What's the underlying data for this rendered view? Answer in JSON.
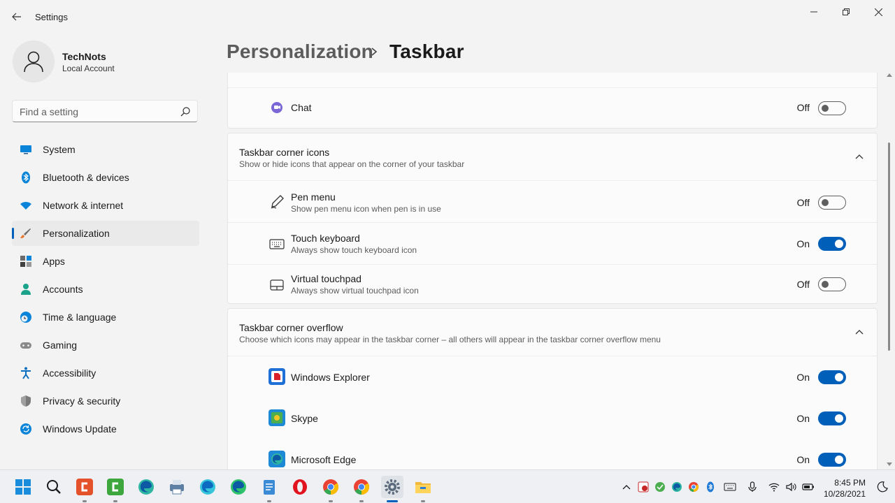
{
  "window": {
    "title": "Settings"
  },
  "profile": {
    "name": "TechNots",
    "account_type": "Local Account"
  },
  "search": {
    "placeholder": "Find a setting"
  },
  "nav": {
    "items": [
      {
        "label": "System",
        "icon": "monitor-icon"
      },
      {
        "label": "Bluetooth & devices",
        "icon": "bluetooth-icon"
      },
      {
        "label": "Network & internet",
        "icon": "wifi-icon"
      },
      {
        "label": "Personalization",
        "icon": "brush-icon",
        "selected": true
      },
      {
        "label": "Apps",
        "icon": "apps-icon"
      },
      {
        "label": "Accounts",
        "icon": "person-icon"
      },
      {
        "label": "Time & language",
        "icon": "globe-clock-icon"
      },
      {
        "label": "Gaming",
        "icon": "gamepad-icon"
      },
      {
        "label": "Accessibility",
        "icon": "accessibility-icon"
      },
      {
        "label": "Privacy & security",
        "icon": "shield-icon"
      },
      {
        "label": "Windows Update",
        "icon": "update-icon"
      }
    ]
  },
  "breadcrumb": {
    "parent": "Personalization",
    "current": "Taskbar"
  },
  "taskbar_items": {
    "chat": {
      "label": "Chat",
      "state": "Off"
    }
  },
  "corner_icons": {
    "title": "Taskbar corner icons",
    "description": "Show or hide icons that appear on the corner of your taskbar",
    "items": [
      {
        "label": "Pen menu",
        "description": "Show pen menu icon when pen is in use",
        "state": "Off",
        "icon": "pen-icon"
      },
      {
        "label": "Touch keyboard",
        "description": "Always show touch keyboard icon",
        "state": "On",
        "icon": "keyboard-icon"
      },
      {
        "label": "Virtual touchpad",
        "description": "Always show virtual touchpad icon",
        "state": "Off",
        "icon": "touchpad-icon"
      }
    ]
  },
  "corner_overflow": {
    "title": "Taskbar corner overflow",
    "description": "Choose which icons may appear in the taskbar corner – all others will appear in the taskbar corner overflow menu",
    "items": [
      {
        "label": "Windows Explorer",
        "state": "On",
        "icon": "explorer-icon"
      },
      {
        "label": "Skype",
        "state": "On",
        "icon": "skype-icon"
      },
      {
        "label": "Microsoft Edge",
        "state": "On",
        "icon": "edge-icon"
      }
    ]
  },
  "system_tray": {
    "time": "8:45 PM",
    "date": "10/28/2021"
  },
  "colors": {
    "accent": "#005fb8",
    "background": "#f3f3f3",
    "card": "#fbfbfb"
  }
}
